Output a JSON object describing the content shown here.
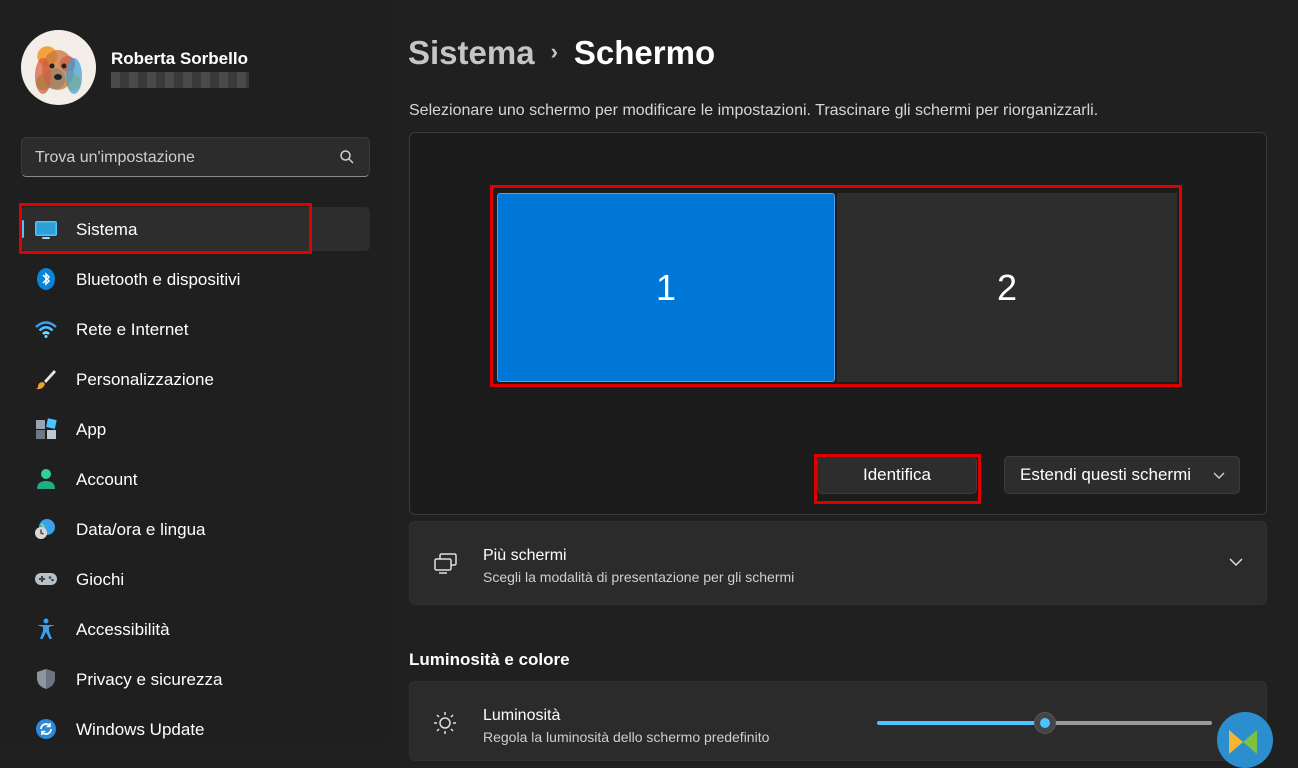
{
  "user": {
    "name": "Roberta Sorbello"
  },
  "search": {
    "placeholder": "Trova un'impostazione"
  },
  "sidebar": {
    "items": [
      {
        "label": "Sistema",
        "icon": "monitor-icon",
        "active": true
      },
      {
        "label": "Bluetooth e dispositivi",
        "icon": "bluetooth-icon"
      },
      {
        "label": "Rete e Internet",
        "icon": "wifi-icon"
      },
      {
        "label": "Personalizzazione",
        "icon": "brush-icon"
      },
      {
        "label": "App",
        "icon": "apps-icon"
      },
      {
        "label": "Account",
        "icon": "account-icon"
      },
      {
        "label": "Data/ora e lingua",
        "icon": "globe-clock-icon"
      },
      {
        "label": "Giochi",
        "icon": "gamepad-icon"
      },
      {
        "label": "Accessibilità",
        "icon": "accessibility-icon"
      },
      {
        "label": "Privacy e sicurezza",
        "icon": "shield-icon"
      },
      {
        "label": "Windows Update",
        "icon": "update-icon"
      }
    ]
  },
  "header": {
    "parent": "Sistema",
    "separator": "›",
    "current": "Schermo"
  },
  "display": {
    "instructions": "Selezionare uno schermo per modificare le impostazioni. Trascinare gli schermi per riorganizzarli.",
    "monitors": [
      "1",
      "2"
    ],
    "identify_label": "Identifica",
    "mode_label": "Estendi questi schermi"
  },
  "multiple_displays": {
    "title": "Più schermi",
    "subtitle": "Scegli la modalità di presentazione per gli schermi"
  },
  "brightness": {
    "section_title": "Luminosità e colore",
    "title": "Luminosità",
    "subtitle": "Regola la luminosità dello schermo predefinito",
    "level": 0.5
  },
  "colors": {
    "accent": "#4cc2ff",
    "monitor_selected": "#0077d6",
    "highlight": "#e00000"
  }
}
